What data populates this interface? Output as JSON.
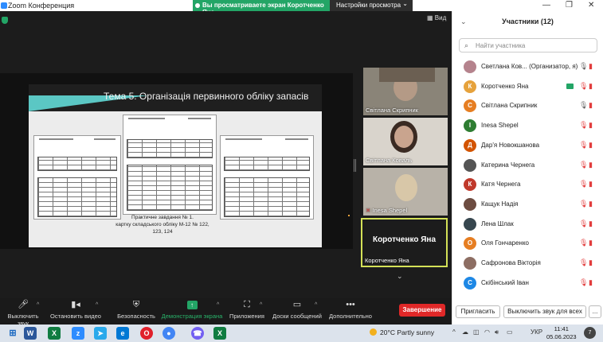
{
  "titlebar": {
    "app_title": "Zoom Конференция",
    "share_banner": "Вы просматриваете экран Коротченко Яна",
    "view_settings": "Настройки просмотра",
    "view_settings_caret": "⌄",
    "minimize": "—",
    "maximize": "❐",
    "close": "✕"
  },
  "meeting": {
    "view_label": "Вид",
    "slide_title": "Тема 5. Організація первинного обліку запасів",
    "slide_caption_line1": "Практичне завдання № 1.",
    "slide_caption_line2": "картку складського обліку М-12 № 122,",
    "slide_caption_line3": "123, 124",
    "video_tiles": [
      {
        "name": "Світлана Скрипник"
      },
      {
        "name": "Світлана Коваль"
      },
      {
        "name": "Inesa Shepel"
      }
    ],
    "active_speaker": {
      "display": "Коротченко Яна",
      "name": "Коротченко Яна"
    }
  },
  "toolbar": {
    "mute": "Выключить звук",
    "video": "Остановить видео",
    "security": "Безопасность",
    "share": "Демонстрация экрана",
    "apps": "Приложения",
    "boards": "Доски сообщений",
    "more": "Дополнительно",
    "end": "Завершение"
  },
  "participants": {
    "header": "Участники (12)",
    "search_placeholder": "Найти участника",
    "items": [
      {
        "name": "Светлана Ков...  (Организатор, я)",
        "initial": "",
        "color": "#b5838d",
        "mic": "on",
        "cam": "off"
      },
      {
        "name": "Коротченко Яна",
        "initial": "К",
        "color": "#e6a23c",
        "mic": "off",
        "cam": "off",
        "sharing": true
      },
      {
        "name": "Світлана Скрипник",
        "initial": "С",
        "color": "#e67e22",
        "mic": "on",
        "cam": "off"
      },
      {
        "name": "Inesa Shepel",
        "initial": "I",
        "color": "#2e7d32",
        "mic": "off",
        "cam": "off"
      },
      {
        "name": "Дар'я Новокшанова",
        "initial": "Д",
        "color": "#d35400",
        "mic": "off",
        "cam": "off"
      },
      {
        "name": "Катерина Чернега",
        "initial": "",
        "color": "#555555",
        "mic": "off",
        "cam": "off"
      },
      {
        "name": "Катя Чернега",
        "initial": "К",
        "color": "#c0392b",
        "mic": "off",
        "cam": "off"
      },
      {
        "name": "Кащук Надія",
        "initial": "",
        "color": "#6d4c41",
        "mic": "off",
        "cam": "off"
      },
      {
        "name": "Лена Шлак",
        "initial": "",
        "color": "#37474f",
        "mic": "off",
        "cam": "off"
      },
      {
        "name": "Оля Гончаренко",
        "initial": "О",
        "color": "#e67e22",
        "mic": "off",
        "cam": "off"
      },
      {
        "name": "Сафронова Вікторія",
        "initial": "",
        "color": "#8d6e63",
        "mic": "off",
        "cam": "off"
      },
      {
        "name": "Скібінський Іван",
        "initial": "С",
        "color": "#1e88e5",
        "mic": "off",
        "cam": "off"
      }
    ],
    "invite": "Пригласить",
    "mute_all": "Выключить звук для всех",
    "more": "..."
  },
  "taskbar": {
    "weather": "20°C  Partly sunny",
    "lang": "УКР",
    "time": "11:41",
    "date": "05.06.2023",
    "notifications": "7"
  }
}
